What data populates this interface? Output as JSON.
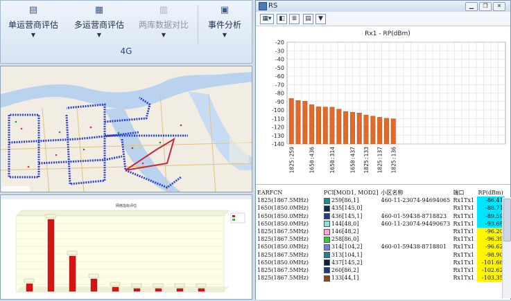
{
  "ribbon": {
    "buttons": [
      {
        "label": "单运营商评估",
        "icon": "document-list-icon",
        "disabled": false
      },
      {
        "label": "多运营商评估",
        "icon": "document-compare-icon",
        "disabled": false
      },
      {
        "label": "两库数据对比",
        "icon": "database-compare-icon",
        "disabled": true
      },
      {
        "label": "事件分析",
        "icon": "event-analysis-icon",
        "disabled": false
      }
    ],
    "group_label": "4G"
  },
  "bar_panel": {
    "title": "网络指标评估"
  },
  "rs_window": {
    "title": "RS",
    "controls": [
      "minimize",
      "restore",
      "close"
    ],
    "toolbar_icons": [
      "chart-type-icon",
      "palette-icon",
      "table-icon",
      "list-icon",
      "filter-icon"
    ]
  },
  "chart_data": {
    "type": "bar",
    "title": "Rx1 - RP(dBm)",
    "categories": [
      "1825:259",
      "1650:436",
      "1650:314",
      "1650:437",
      "1825:133",
      "1825:137",
      "1825:136"
    ],
    "values": [
      -86.4,
      -88.7,
      -89.6,
      -93.7,
      -96.2,
      -96.4,
      -96.6,
      -98.9,
      -101.7,
      -102.6,
      -103.4,
      -105.8,
      -107.2,
      -108.5,
      -109.7,
      -110.4
    ],
    "ylim": [
      -140,
      -20
    ],
    "yticks": [
      -20,
      -30,
      -40,
      -50,
      -60,
      -70,
      -80,
      -90,
      -100,
      -110,
      -120,
      -130,
      -140
    ],
    "color": "#e06a2a",
    "grid": true
  },
  "table": {
    "headers": [
      "EARFCN",
      "PCI[MOD1, MOD2]",
      "小区名称",
      "端口",
      "RP(dBm)"
    ],
    "rows": [
      {
        "earfcn": "1825(1867.5MHz)",
        "pci": "259[86,1]",
        "color": "#1a8e8e",
        "cell": "460-11-23074-94694065",
        "port": "Rx1Tx1",
        "rp": "-86.41",
        "rpcolor": "#00e5ff"
      },
      {
        "earfcn": "1650(1850.0MHz)",
        "pci": "435[145,0]",
        "color": "#0d2b4e",
        "cell": "",
        "port": "Rx1Tx1",
        "rp": "-88.71",
        "rpcolor": "#00e5ff"
      },
      {
        "earfcn": "1650(1850.0MHz)",
        "pci": "436[145,1]",
        "color": "#1d3e8a",
        "cell": "460-01-59438-8718823",
        "port": "Rx1Tx1",
        "rp": "-89.59",
        "rpcolor": "#00e5ff"
      },
      {
        "earfcn": "1650(1850.0MHz)",
        "pci": "144[48,0]",
        "color": "#8be0e0",
        "cell": "460-11-23074-94490673",
        "port": "Rx1Tx1",
        "rp": "-93.68",
        "rpcolor": "#00e5ff"
      },
      {
        "earfcn": "1825(1867.5MHz)",
        "pci": "146[48,2]",
        "color": "#f7a6d8",
        "cell": "",
        "port": "Rx1Tx1",
        "rp": "-96.20",
        "rpcolor": "#fff500"
      },
      {
        "earfcn": "1825(1867.5MHz)",
        "pci": "258[86,0]",
        "color": "#31c843",
        "cell": "",
        "port": "Rx1Tx1",
        "rp": "-96.39",
        "rpcolor": "#fff500"
      },
      {
        "earfcn": "1650(1850.0MHz)",
        "pci": "314[104,2]",
        "color": "#7a7fd6",
        "cell": "460-01-59438-8718801",
        "port": "Rx1Tx1",
        "rp": "-96.62",
        "rpcolor": "#fff500"
      },
      {
        "earfcn": "1825(1867.5MHz)",
        "pci": "313[104,1]",
        "color": "#2a7a9e",
        "cell": "",
        "port": "Rx1Tx1",
        "rp": "-98.90",
        "rpcolor": "#fff500"
      },
      {
        "earfcn": "1650(1850.0MHz)",
        "pci": "437[145,2]",
        "color": "#0b1f38",
        "cell": "",
        "port": "Rx1Tx1",
        "rp": "-101.66",
        "rpcolor": "#fff500"
      },
      {
        "earfcn": "1825(1867.5MHz)",
        "pci": "260[86,2]",
        "color": "#1c3b7a",
        "cell": "",
        "port": "Rx1Tx1",
        "rp": "-102.62",
        "rpcolor": "#fff500"
      },
      {
        "earfcn": "1825(1867.5MHz)",
        "pci": "133[44,1]",
        "color": "#8a4b1c",
        "cell": "",
        "port": "Rx1Tx1",
        "rp": "-103.35",
        "rpcolor": "#fff500"
      }
    ]
  }
}
